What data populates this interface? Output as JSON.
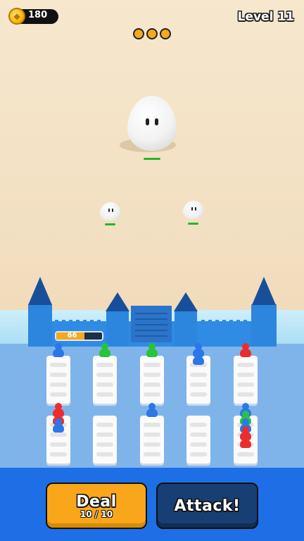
{
  "hud": {
    "coins": "180",
    "coin_icon": "coin-icon",
    "level": "Level 11",
    "wave_dots": 3
  },
  "fortress": {
    "hp": "66",
    "hp_fraction": 0.62
  },
  "units": {
    "slot_0_top": [
      "blue"
    ],
    "slot_1_top": [
      "green"
    ],
    "slot_2_top": [
      "green"
    ],
    "slot_3_top": [
      "blue",
      "blue"
    ],
    "slot_4_top": [
      "red"
    ],
    "slot_0_bottom": [
      "red",
      "red",
      "blue"
    ],
    "slot_2_bottom": [
      "blue"
    ],
    "slot_4_bottom": [
      "blue",
      "green",
      "blue",
      "red",
      "red"
    ]
  },
  "buttons": {
    "deal_label": "Deal",
    "deal_count": "10 / 10",
    "attack_label": "Attack!"
  },
  "colors": {
    "deal": "#f9a61a",
    "attack": "#173f74",
    "castle": "#2f8be3",
    "unit_blue": "#2b77ea",
    "unit_green": "#28c43a",
    "unit_red": "#ea2d2d"
  }
}
